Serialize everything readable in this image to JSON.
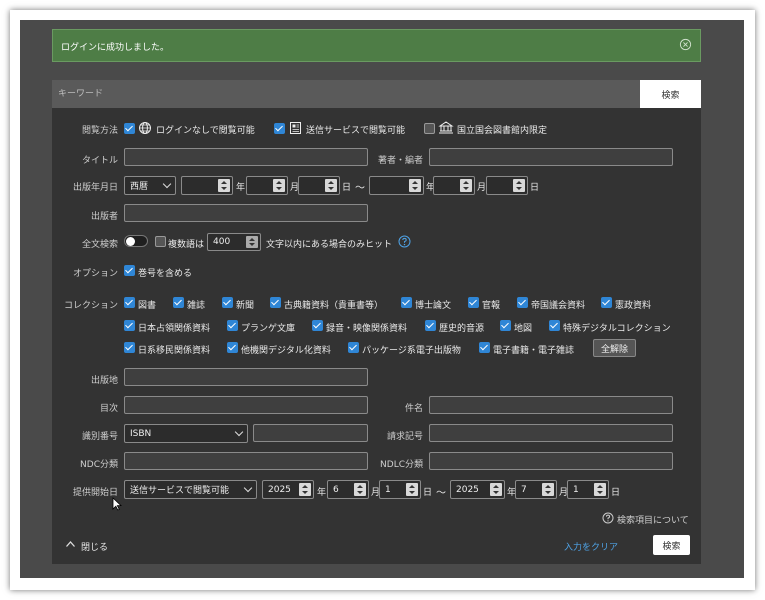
{
  "alert": {
    "text": "ログインに成功しました。"
  },
  "keyword": {
    "placeholder": "キーワード",
    "search_label": "検索"
  },
  "access": {
    "label": "閲覧方法",
    "opt1": "ログインなしで閲覧可能",
    "opt2": "送信サービスで閲覧可能",
    "opt3": "国立国会図書館内限定"
  },
  "fields": {
    "title": "タイトル",
    "author": "著者・編者",
    "pubdate": "出版年月日",
    "era": "西暦",
    "year": "年",
    "month": "月",
    "day": "日",
    "tilde": "～",
    "publisher": "出版者",
    "fulltext": "全文検索",
    "multi": "複数語は",
    "multi_value": "400",
    "multi_suffix": "文字以内にある場合のみヒット",
    "option": "オプション",
    "volume": "巻号を含める",
    "collection": "コレクション",
    "place": "出版地",
    "toc": "目次",
    "subject": "件名",
    "identifier": "識別番号",
    "identifier_type": "ISBN",
    "callno": "請求記号",
    "ndc": "NDC分類",
    "ndlc": "NDLC分類",
    "provide": "提供開始日",
    "provide_type": "送信サービスで閲覧可能",
    "from_year": "2025",
    "from_month": "6",
    "from_day": "1",
    "to_year": "2025",
    "to_month": "7",
    "to_day": "1"
  },
  "collections": [
    "図書",
    "雑誌",
    "新聞",
    "古典籍資料（貴重書等）",
    "博士論文",
    "官報",
    "帝国議会資料",
    "憲政資料",
    "日本占領関係資料",
    "プランゲ文庫",
    "録音・映像関係資料",
    "歴史的音源",
    "地図",
    "特殊デジタルコレクション",
    "日系移民関係資料",
    "他機関デジタル化資料",
    "パッケージ系電子出版物",
    "電子書籍・電子雑誌"
  ],
  "clear_all": "全解除",
  "help": "検索項目について",
  "close": "閉じる",
  "clear_input": "入力をクリア",
  "search": "検索"
}
